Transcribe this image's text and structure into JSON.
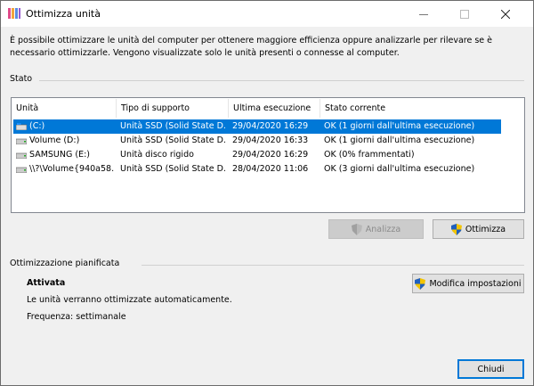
{
  "window": {
    "title": "Ottimizza unità",
    "icons": {
      "app": "defrag-icon",
      "minimize": "minimize-icon",
      "maximize": "maximize-icon",
      "close": "close-icon"
    }
  },
  "description": "È possibile ottimizzare le unità del computer per ottenere maggiore efficienza oppure analizzarle per rilevare se è necessario ottimizzarle. Vengono visualizzate solo le unità presenti o connesse al computer.",
  "stato": {
    "label": "Stato",
    "columns": [
      "Unità",
      "Tipo di supporto",
      "Ultima esecuzione",
      "Stato corrente"
    ],
    "rows": [
      {
        "drive": "(C:)",
        "media": "Unità SSD (Solid State D...",
        "last": "29/04/2020 16:29",
        "status": "OK (1 giorni dall'ultima esecuzione)",
        "selected": true,
        "icon": "windows-drive-icon"
      },
      {
        "drive": "Volume (D:)",
        "media": "Unità SSD (Solid State D...",
        "last": "29/04/2020 16:33",
        "status": "OK (1 giorni dall'ultima esecuzione)",
        "selected": false,
        "icon": "drive-icon"
      },
      {
        "drive": "SAMSUNG (E:)",
        "media": "Unità disco rigido",
        "last": "29/04/2020 16:29",
        "status": "OK (0% frammentati)",
        "selected": false,
        "icon": "drive-icon"
      },
      {
        "drive": "\\\\?\\Volume{940a58...",
        "media": "Unità SSD (Solid State D...",
        "last": "28/04/2020 11:06",
        "status": "OK (3 giorni dall'ultima esecuzione)",
        "selected": false,
        "icon": "drive-icon"
      }
    ]
  },
  "buttons": {
    "analizza": "Analizza",
    "ottimizza": "Ottimizza",
    "modifica": "Modifica impostazioni",
    "chiudi": "Chiudi"
  },
  "scheduled": {
    "label": "Ottimizzazione pianificata",
    "state": "Attivata",
    "line1": "Le unità verranno ottimizzate automaticamente.",
    "frequency": "Frequenza: settimanale"
  }
}
